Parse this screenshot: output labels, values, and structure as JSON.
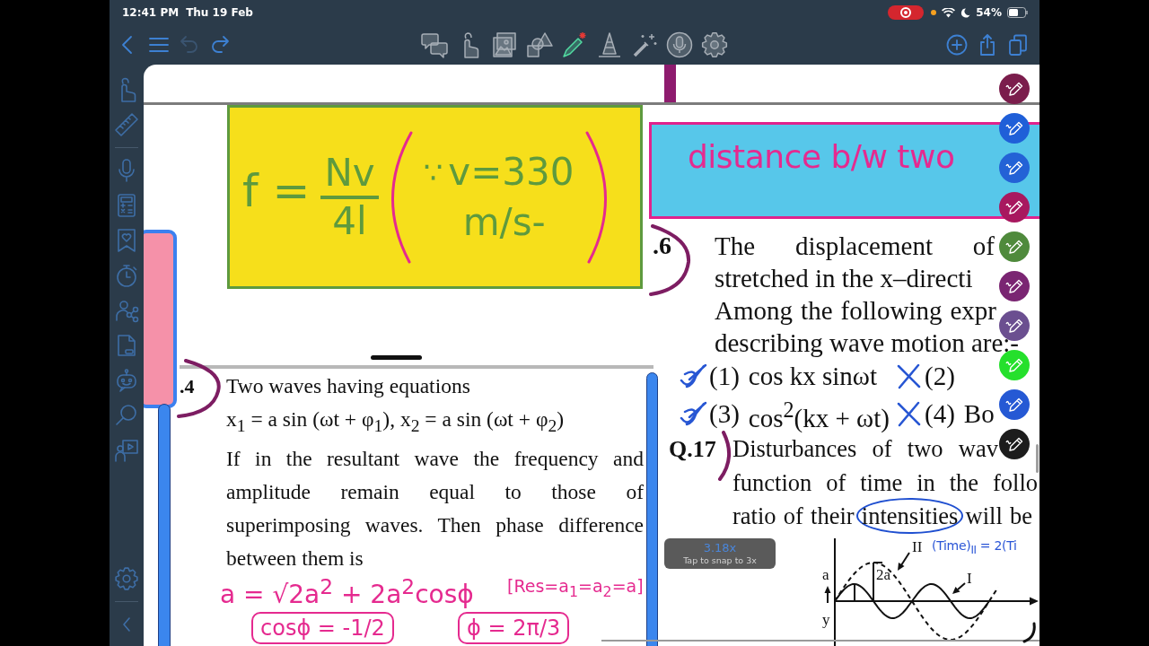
{
  "status_bar": {
    "time": "12:41 PM",
    "date": "Thu 19 Feb",
    "recording": true,
    "battery": "54%"
  },
  "toolbar": {
    "undo": {
      "disabled": true
    },
    "redo": {
      "disabled": false
    },
    "tools": [
      {
        "selected": false
      },
      {
        "selected": false
      },
      {
        "selected": false
      },
      {
        "selected": false
      },
      {
        "selected": true
      },
      {
        "selected": false
      },
      {
        "selected": false
      },
      {
        "selected": false
      },
      {
        "selected": false
      }
    ]
  },
  "page": {
    "formula_note": {
      "lhs": "f =",
      "numerator": "Nv",
      "denominator": "4l",
      "because": "∵",
      "condition": "v=330",
      "unit": "m/s-"
    },
    "distance_note": {
      "text": "distance b/w two"
    },
    "question_4": {
      "number": ".4",
      "title": "Two waves having equations",
      "equation": "x$_{1}$ = a sin (ωt + φ$_{1}$), x$_{2}$ = a sin (ωt + φ$_{2}$)",
      "body": "If in the resultant wave the frequency and amplitude remain equal to those of superimposing waves. Then phase difference between them is"
    },
    "working": {
      "amplitude": "a = √2a$^{2}$ + 2a$^{2}$cosϕ",
      "condition": "[Res=a$_{1}$=a$_{2}$=a]",
      "cosine": "cosϕ = -1/2",
      "phase": "ϕ = 2π/3"
    },
    "question_6": {
      "number": ".6",
      "lines": [
        "The displacement of",
        "stretched in the x–directi",
        "Among the following expr",
        "describing wave motion are:-"
      ],
      "options": [
        {
          "label": "(1)",
          "text": "cos kx sinωt",
          "kind": "ticked"
        },
        {
          "label": "(2)",
          "kind": "crossed"
        },
        {
          "label": "(3)",
          "text": "cos$^{2}$(kx + ωt)",
          "kind": "ticked"
        },
        {
          "label": "(4)",
          "text": "Bo",
          "kind": "crossed"
        }
      ]
    },
    "question_17": {
      "number": "Q.17",
      "lines": [
        {
          "text": "Disturbances of two wav"
        },
        {
          "text": "function of time in the follo"
        },
        {
          "text": "ratio of their",
          "circled": "intensities",
          "after": "will be"
        }
      ],
      "figure": {
        "curve_2_label": "II",
        "amplitude_2": "2a",
        "amplitude_1": "a",
        "curve_1_label": "I",
        "axis_label": "y",
        "note": "(Time)$_{II}$ = 2(Ti"
      }
    }
  },
  "zoom_badge": {
    "zoom": "3.18x",
    "hint": "Tap to snap to 3x"
  },
  "pens": [
    {
      "color": "#7b1d4c"
    },
    {
      "color": "#1f5fd8"
    },
    {
      "color": "#2362d6"
    },
    {
      "color": "#a8185f"
    },
    {
      "color": "#4f8a3c"
    },
    {
      "color": "#7a2572"
    },
    {
      "color": "#6b4f90"
    },
    {
      "color": "#25e02c"
    },
    {
      "color": "#2559d4"
    },
    {
      "color": "#1c1c1c"
    }
  ]
}
